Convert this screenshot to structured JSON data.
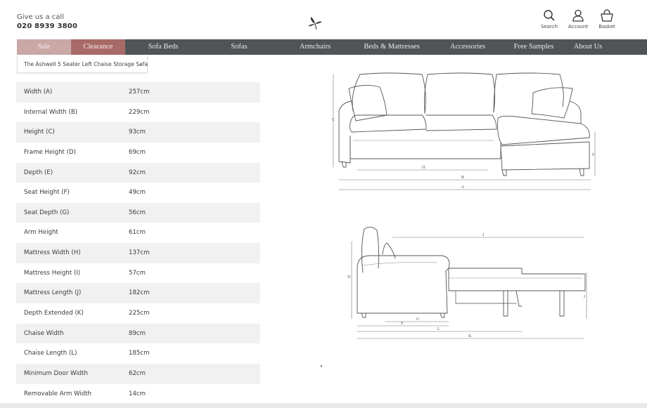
{
  "header": {
    "call_label": "Give us a call",
    "call_number": "020 8939 3800",
    "icons": [
      {
        "name": "search-icon",
        "label": "Search"
      },
      {
        "name": "account-icon",
        "label": "Account"
      },
      {
        "name": "basket-icon",
        "label": "Basket"
      }
    ]
  },
  "nav": {
    "items": [
      "Sale",
      "Clearance",
      "Sofa Beds",
      "Sofas",
      "Armchairs",
      "Beds & Mattresses",
      "Accessories",
      "Free Samples",
      "About Us"
    ]
  },
  "product_select": {
    "value": "The Ashwell 5 Seater Left Chaise Storage Sofa"
  },
  "specs": [
    {
      "label": "Width (A)",
      "value": "257cm"
    },
    {
      "label": "Internal Width (B)",
      "value": "229cm"
    },
    {
      "label": "Height (C)",
      "value": "93cm"
    },
    {
      "label": "Frame Height (D)",
      "value": "69cm"
    },
    {
      "label": "Depth (E)",
      "value": "92cm"
    },
    {
      "label": "Seat Height (F)",
      "value": "49cm"
    },
    {
      "label": "Seat Depth (G)",
      "value": "56cm"
    },
    {
      "label": "Arm Height",
      "value": "61cm"
    },
    {
      "label": "Mattress Width (H)",
      "value": "137cm"
    },
    {
      "label": "Mattress Height (I)",
      "value": "57cm"
    },
    {
      "label": "Mattress Length (J)",
      "value": "182cm"
    },
    {
      "label": "Depth Extended (K)",
      "value": "225cm"
    },
    {
      "label": "Chaise Width",
      "value": "89cm"
    },
    {
      "label": "Chaise Length (L)",
      "value": "185cm"
    },
    {
      "label": "Minimum Door Width",
      "value": "62cm"
    },
    {
      "label": "Removable Arm Width",
      "value": "14cm"
    }
  ],
  "diagram_labels": {
    "front": [
      "C",
      "H",
      "B",
      "A",
      "F"
    ],
    "side": [
      "J",
      "D",
      "G",
      "E",
      "L",
      "K",
      "I"
    ]
  }
}
